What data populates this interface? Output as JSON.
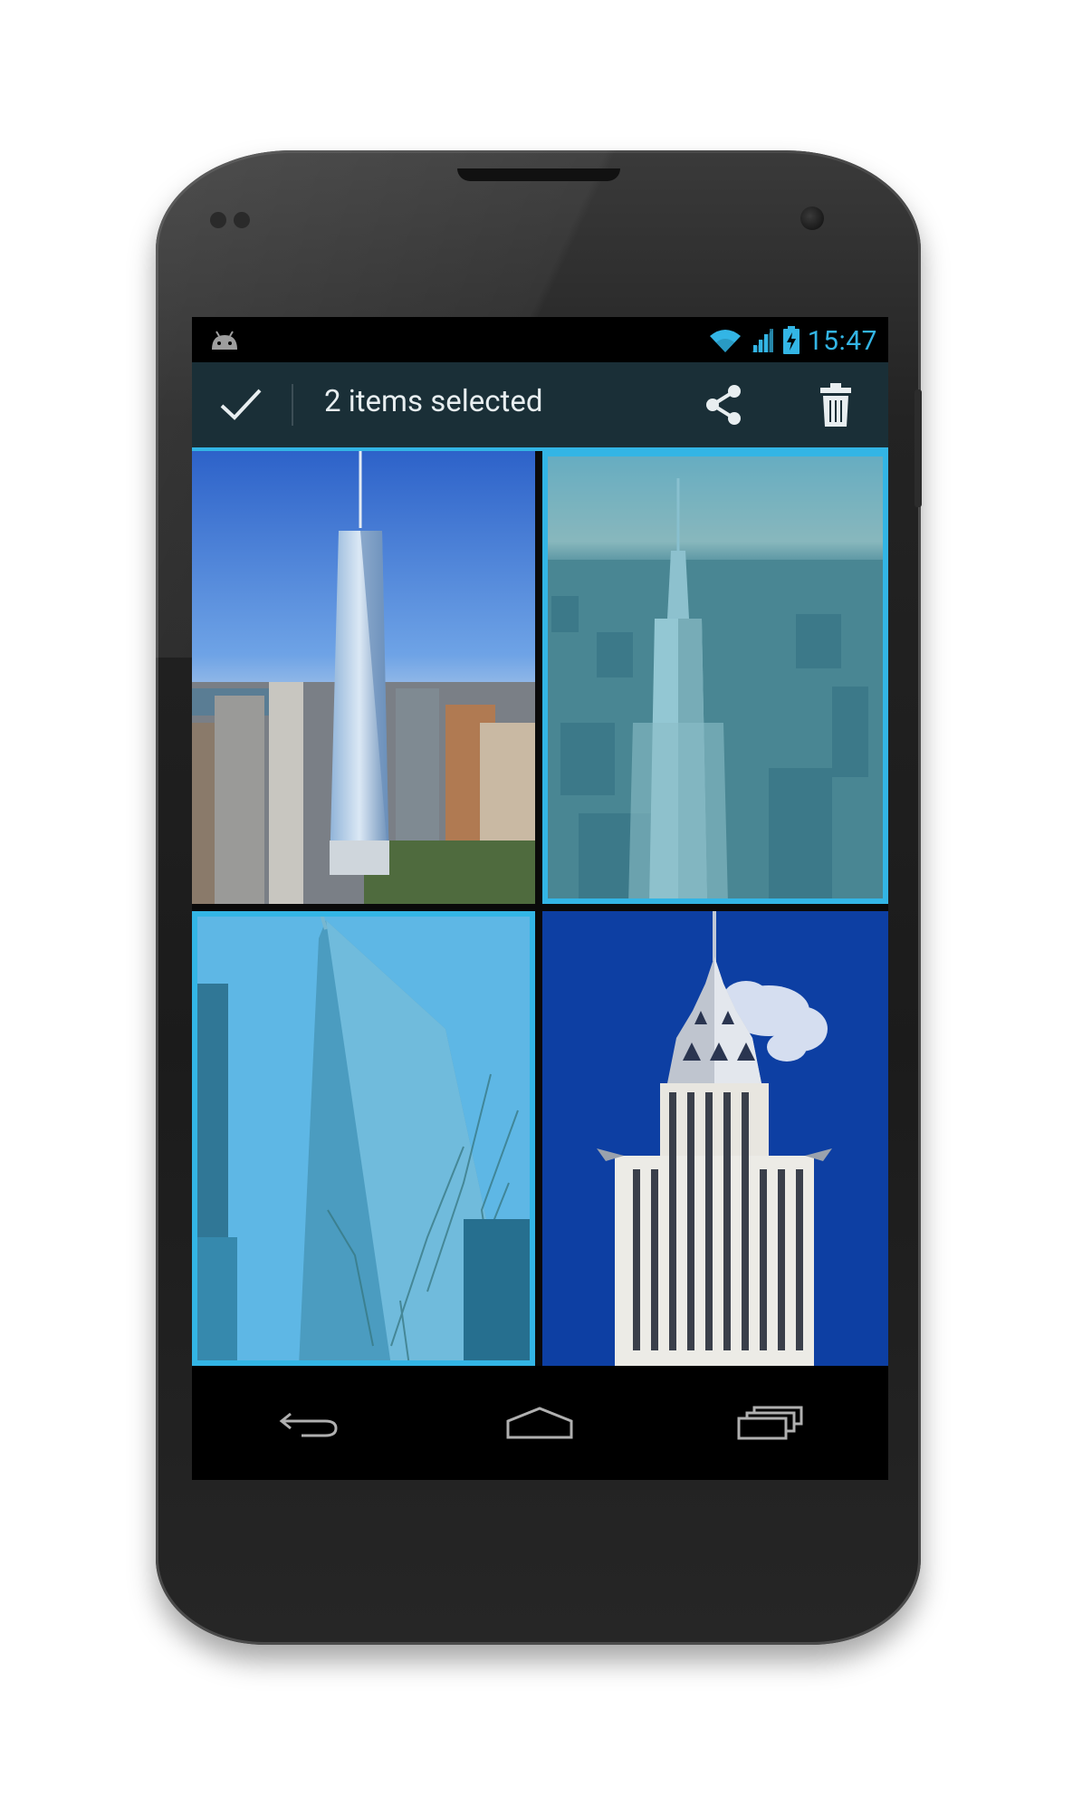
{
  "status_bar": {
    "time": "15:47",
    "notification_icon": "android-icon",
    "icons": [
      "wifi-icon",
      "signal-icon",
      "battery-charging-icon"
    ]
  },
  "action_bar": {
    "done_icon": "checkmark-icon",
    "title": "2 items selected",
    "actions": [
      "share-icon",
      "trash-icon"
    ]
  },
  "gallery": {
    "items": [
      {
        "subject": "one-world-trade-center",
        "selected": false
      },
      {
        "subject": "empire-state-building",
        "selected": true
      },
      {
        "subject": "bank-of-america-tower",
        "selected": true
      },
      {
        "subject": "chrysler-building",
        "selected": false
      }
    ]
  },
  "nav_bar": {
    "buttons": [
      "back-icon",
      "home-icon",
      "recent-apps-icon"
    ]
  },
  "colors": {
    "accent": "#33b5e5",
    "action_bar_bg": "#1a2f37",
    "status_bar_bg": "#000000",
    "text_light": "#e8eef0"
  }
}
